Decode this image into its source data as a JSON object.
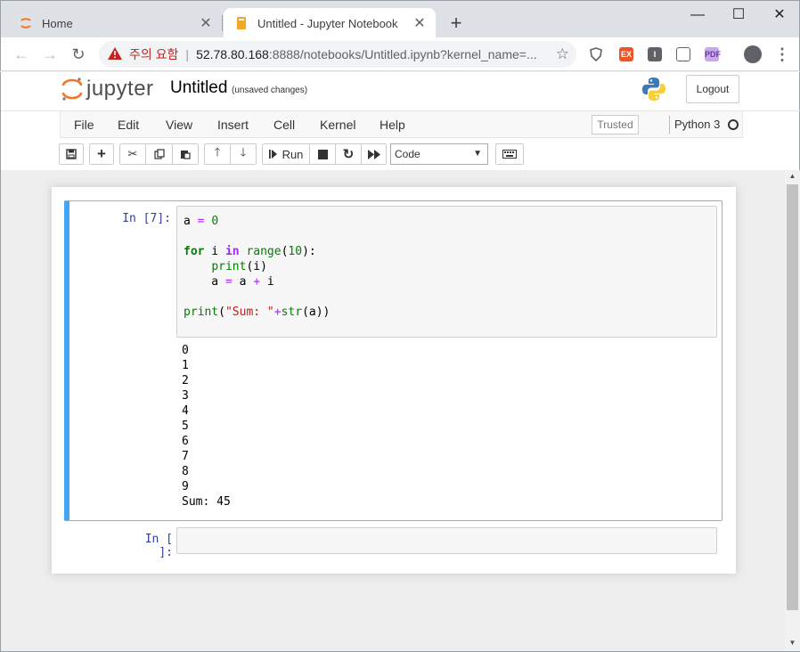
{
  "browser": {
    "tabs": [
      {
        "label": "Home",
        "active": false
      },
      {
        "label": "Untitled - Jupyter Notebook",
        "active": true
      }
    ],
    "new_tab": "+",
    "window_controls": {
      "minimize": "—",
      "maximize": "☐",
      "close": "✕"
    },
    "address": {
      "warning_text": "주의 요함",
      "separator": "|",
      "host": "52.78.80.168",
      "rest": ":8888/notebooks/Untitled.ipynb?kernel_name=..."
    },
    "icons": [
      "back-icon",
      "forward-icon",
      "reload-icon",
      "warning-icon",
      "star-icon",
      "shield-icon",
      "ex-icon",
      "i-icon",
      "screen-icon",
      "pdf-icon",
      "profile-icon",
      "menu-icon"
    ]
  },
  "jupyter": {
    "logo_text": "jupyter",
    "notebook_title": "Untitled",
    "save_status": "(unsaved changes)",
    "logout_label": "Logout",
    "menu": [
      "File",
      "Edit",
      "View",
      "Insert",
      "Cell",
      "Kernel",
      "Help"
    ],
    "trusted_label": "Trusted",
    "kernel_name": "Python 3",
    "toolbar": {
      "run_label": "Run",
      "cell_type": "Code"
    }
  },
  "cells": [
    {
      "prompt": "In [7]:",
      "code": [
        "a = 0",
        "",
        "for i in range(10):",
        "    print(i)",
        "    a = a + i",
        "",
        "print(\"Sum: \"+str(a))"
      ],
      "output": "0\n1\n2\n3\n4\n5\n6\n7\n8\n9\nSum: 45"
    },
    {
      "prompt": "In [ ]:",
      "code": []
    }
  ],
  "colors": {
    "selected_cell_bar": "#42a5f5",
    "prompt": "#303f9f",
    "warning": "#c5221f"
  }
}
